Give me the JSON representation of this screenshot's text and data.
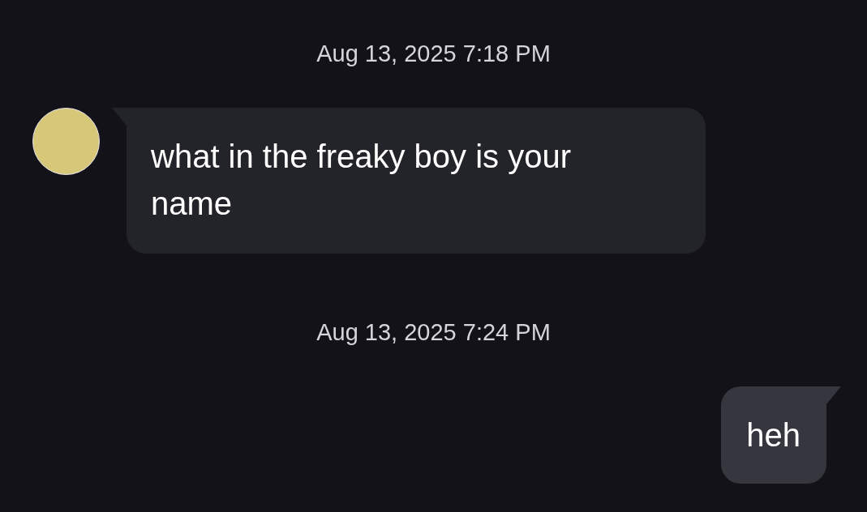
{
  "messages": [
    {
      "kind": "timestamp",
      "text": "Aug 13, 2025 7:18 PM"
    },
    {
      "kind": "incoming",
      "text": "what in the freaky boy is your name"
    },
    {
      "kind": "timestamp",
      "text": "Aug 13, 2025 7:24 PM"
    },
    {
      "kind": "outgoing",
      "text": "heh"
    }
  ]
}
